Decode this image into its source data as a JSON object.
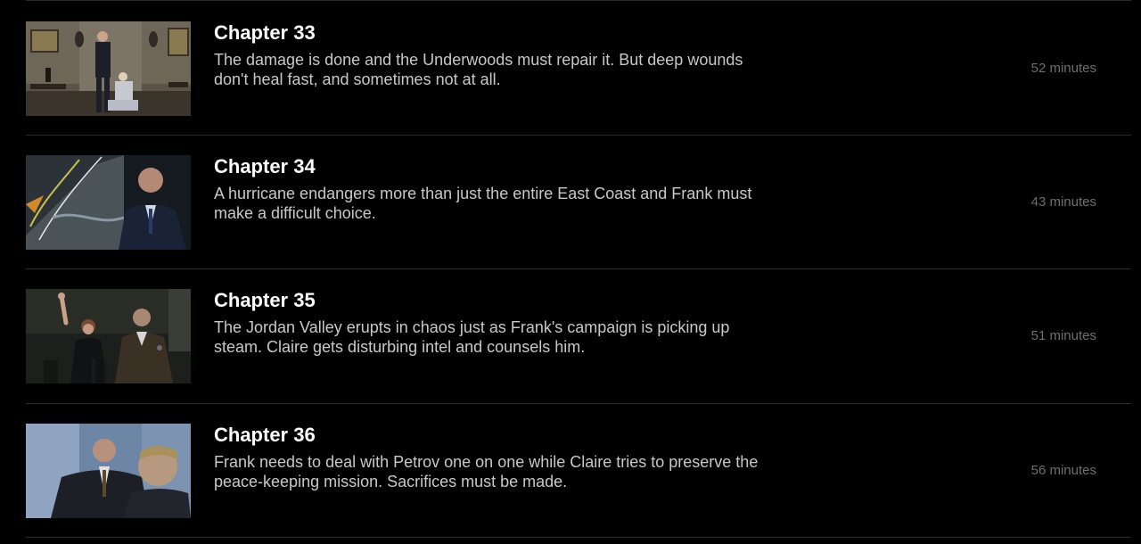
{
  "episodes": [
    {
      "title": "Chapter 33",
      "description": "The damage is done and the Underwoods must repair it. But deep wounds don't heal fast, and sometimes not at all.",
      "duration": "52 minutes"
    },
    {
      "title": "Chapter 34",
      "description": "A hurricane endangers more than just the entire East Coast and Frank must make a difficult choice.",
      "duration": "43 minutes"
    },
    {
      "title": "Chapter 35",
      "description": "The Jordan Valley erupts in chaos just as Frank's campaign is picking up steam. Claire gets disturbing intel and counsels him.",
      "duration": "51 minutes"
    },
    {
      "title": "Chapter 36",
      "description": "Frank needs to deal with Petrov one on one while Claire tries to preserve the peace-keeping mission. Sacrifices must be made.",
      "duration": "56 minutes"
    }
  ]
}
